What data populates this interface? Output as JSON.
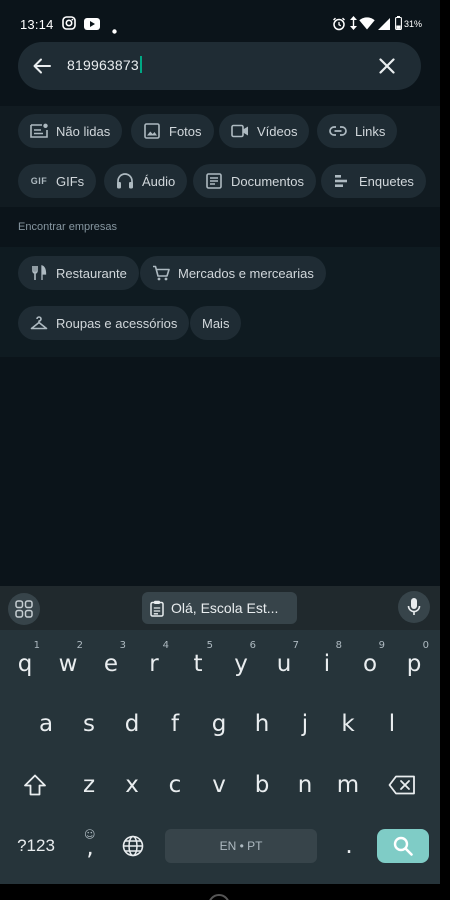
{
  "status_bar": {
    "time": "13:14",
    "battery": "31%",
    "icons": [
      "instagram-icon",
      "youtube-icon",
      "dot-icon",
      "alarm-icon",
      "data-arrows-icon",
      "wifi-icon",
      "signal-icon",
      "battery-icon"
    ]
  },
  "search": {
    "value": "819963873",
    "back_icon": "arrow-left-icon",
    "clear_icon": "close-icon"
  },
  "filters": {
    "row1": [
      {
        "label": "Não lidas",
        "icon": "unread-icon"
      },
      {
        "label": "Fotos",
        "icon": "photo-icon"
      },
      {
        "label": "Vídeos",
        "icon": "video-icon"
      },
      {
        "label": "Links",
        "icon": "link-icon"
      }
    ],
    "row2": [
      {
        "label": "GIFs",
        "icon": "gif-icon",
        "icon_text": "GIF"
      },
      {
        "label": "Áudio",
        "icon": "headphones-icon"
      },
      {
        "label": "Documentos",
        "icon": "document-icon"
      },
      {
        "label": "Enquetes",
        "icon": "poll-icon"
      }
    ]
  },
  "business": {
    "title": "Encontrar empresas",
    "row1": [
      {
        "label": "Restaurante",
        "icon": "restaurant-icon"
      },
      {
        "label": "Mercados e mercearias",
        "icon": "cart-icon"
      }
    ],
    "row2": [
      {
        "label": "Roupas e acessórios",
        "icon": "hanger-icon"
      },
      {
        "label": "Mais",
        "icon": ""
      }
    ]
  },
  "keyboard": {
    "suggestion": "Olá, Escola Est...",
    "row1": [
      {
        "key": "q",
        "hint": "1"
      },
      {
        "key": "w",
        "hint": "2"
      },
      {
        "key": "e",
        "hint": "3"
      },
      {
        "key": "r",
        "hint": "4"
      },
      {
        "key": "t",
        "hint": "5"
      },
      {
        "key": "y",
        "hint": "6"
      },
      {
        "key": "u",
        "hint": "7"
      },
      {
        "key": "i",
        "hint": "8"
      },
      {
        "key": "o",
        "hint": "9"
      },
      {
        "key": "p",
        "hint": "0"
      }
    ],
    "row2": [
      "a",
      "s",
      "d",
      "f",
      "g",
      "h",
      "j",
      "k",
      "l"
    ],
    "row3": [
      "z",
      "x",
      "c",
      "v",
      "b",
      "n",
      "m"
    ],
    "sym_label": "?123",
    "comma": ",",
    "space_label": "EN • PT",
    "period": "."
  }
}
